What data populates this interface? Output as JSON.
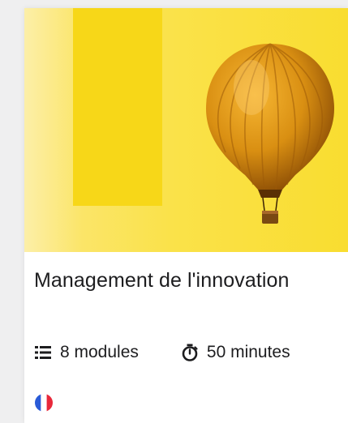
{
  "course": {
    "title": "Management de l'innovation",
    "modules_label": "8 modules",
    "duration_label": "50 minutes",
    "language": "French",
    "hero_image": "hot-air-balloon-on-yellow-background"
  },
  "icons": {
    "modules": "list-icon",
    "duration": "stopwatch-icon",
    "language": "france-flag-icon"
  },
  "colors": {
    "hero_yellow": "#f9dd30",
    "accent_block": "#f7d718",
    "text": "#1d1d1f",
    "flag_blue": "#2a5bd7",
    "flag_red": "#e8283a"
  }
}
